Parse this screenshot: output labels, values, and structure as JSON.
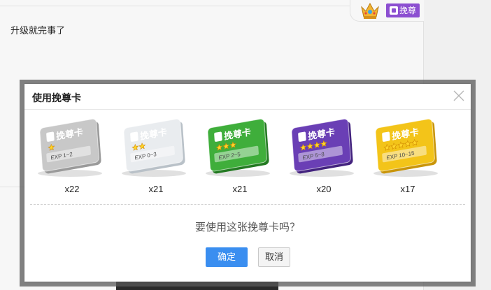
{
  "background": {
    "post_text": "升级就完事了",
    "badge_label": "挽尊"
  },
  "dialog": {
    "title": "使用挽尊卡",
    "question": "要使用这张挽尊卡吗？",
    "confirm_label": "确定",
    "cancel_label": "取消"
  },
  "cards": [
    {
      "name": "挽尊卡",
      "exp": "EXP 1~2",
      "stars": 1,
      "count": "x22",
      "color": "#c8c8c8",
      "color_dark": "#9a9a9a"
    },
    {
      "name": "挽尊卡",
      "exp": "EXP 0~3",
      "stars": 2,
      "count": "x21",
      "color": "#e9ecef",
      "color_dark": "#b9c1c8"
    },
    {
      "name": "挽尊卡",
      "exp": "EXP 2~5",
      "stars": 3,
      "count": "x21",
      "color": "#3fae3b",
      "color_dark": "#237a22"
    },
    {
      "name": "挽尊卡",
      "exp": "EXP 5~8",
      "stars": 4,
      "count": "x20",
      "color": "#6a3fb5",
      "color_dark": "#43237e"
    },
    {
      "name": "挽尊卡",
      "exp": "EXP 10~15",
      "stars": 5,
      "count": "x17",
      "color": "#f3c419",
      "color_dark": "#c9950a"
    }
  ]
}
